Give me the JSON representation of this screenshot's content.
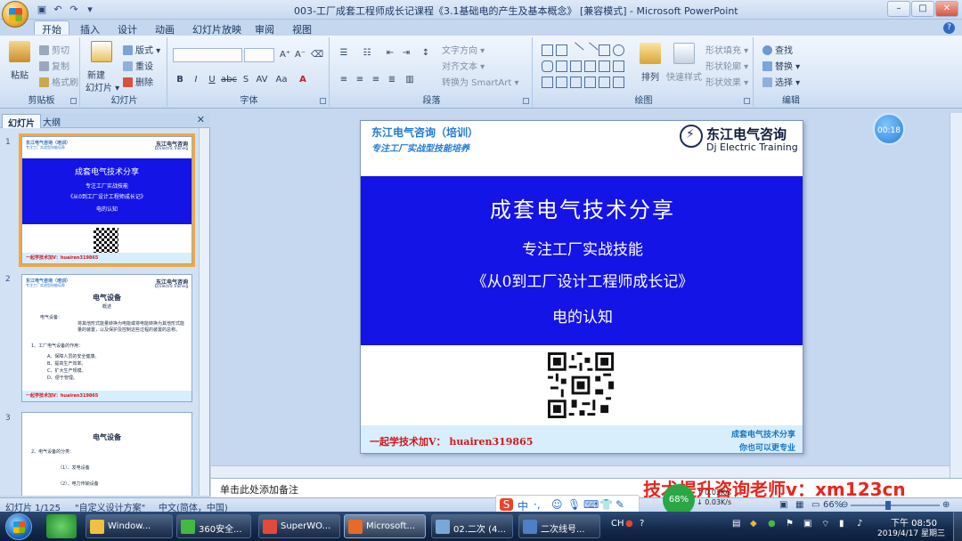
{
  "window": {
    "title": "003-工厂成套工程师成长记课程《3.1基础电的产生及基本概念》 [兼容模式] - Microsoft PowerPoint",
    "minimize": "–",
    "maximize": "□",
    "close": "✕"
  },
  "quick_access": [
    "save-icon",
    "undo-icon",
    "redo-icon"
  ],
  "tabs": [
    "开始",
    "插入",
    "设计",
    "动画",
    "幻灯片放映",
    "审阅",
    "视图"
  ],
  "ribbon": {
    "clipboard": {
      "label": "剪贴板",
      "paste": "粘贴",
      "cut": "剪切",
      "copy": "复制",
      "format_painter": "格式刷"
    },
    "slides": {
      "label": "幻灯片",
      "new_slide": "新建",
      "new_slide2": "幻灯片 ▾",
      "layout": "版式 ▾",
      "reset": "重设",
      "delete": "删除"
    },
    "font": {
      "label": "字体",
      "grow": "A⁺",
      "shrink": "A⁻",
      "bold": "B",
      "italic": "I",
      "underline": "U",
      "strike": "abc",
      "shadow": "S",
      "spacing": "AV",
      "case": "Aa",
      "color": "A"
    },
    "paragraph": {
      "label": "段落",
      "text_direction": "文字方向 ▾",
      "align_text": "对齐文本 ▾",
      "smartart": "转换为 SmartArt ▾"
    },
    "drawing": {
      "label": "绘图",
      "arrange": "排列",
      "quick_styles": "快速样式",
      "fill": "形状填充 ▾",
      "outline": "形状轮廓 ▾",
      "effects": "形状效果 ▾"
    },
    "editing": {
      "label": "编辑",
      "find": "查找",
      "replace": "替换 ▾",
      "select": "选择 ▾"
    }
  },
  "panel_tabs": [
    "幻灯片",
    "大纲"
  ],
  "panel_close": "✕",
  "thumbnails": [
    {
      "num": "1",
      "hdr1": "东江电气咨询（培训）",
      "hdr2": "专注工厂实战型技能培养",
      "logo": "东江电气咨询",
      "logo2": "Dj Electric Training",
      "line1": "成套电气技术分享",
      "line2": "专注工厂实战技能",
      "line3": "《从0到工厂设计工程师成长记》",
      "line4": "电的认知",
      "footer": "一起学技术加V：huairen319865"
    },
    {
      "num": "2",
      "title": "电气设备",
      "sub": "概述",
      "p1": "电气设备：",
      "p2": "将其他形式能量转换为电能或将电能转换为其他形式能量的装置，以及保护及控制这些过程的装置的总称。",
      "p3": "1、工厂电气设备的作用：",
      "items": [
        "A、保障人员的安全健康。",
        "B、提高生产效率。",
        "C、扩大生产规模。",
        "D、便于管理。"
      ],
      "footer": "一起学技术加V：huairen319865"
    },
    {
      "num": "3",
      "title": "电气设备",
      "p1": "2、电气设备的分类：",
      "items": [
        "（1）、发电设备",
        "（2）、电力传输设备"
      ]
    }
  ],
  "slide": {
    "hdr1": "东江电气咨询（培训）",
    "hdr2": "专注工厂实战型技能培养",
    "logo_cn": "东江电气咨询",
    "logo_en": "Dj Electric Training",
    "title": "成套电气技术分享",
    "line2": "专注工厂实战技能",
    "line3": "《从0到工厂设计工程师成长记》",
    "line4": "电的认知",
    "footer": "一起学技术加V： huairen319865",
    "footer_r1": "成套电气技术分享",
    "footer_r2": "你也可以更专业"
  },
  "timer": "00:18",
  "notes": "单击此处添加备注",
  "watermark": "技术提升咨询老师v：xm123cn",
  "statusbar": {
    "slide_count": "幻灯片 1/125",
    "theme": "\"自定义设计方案\"",
    "language": "中文(简体，中国)",
    "zoom": "66%",
    "zoom_minus": "⊖",
    "zoom_plus": "⊕"
  },
  "ime": {
    "s": "S",
    "lang": "中",
    "punct": "·,"
  },
  "net": {
    "percent": "68%",
    "up": "↑ 0.03K/s",
    "down": "↓ 0.03K/s"
  },
  "taskbar": {
    "items": [
      {
        "label": "Window...",
        "color": "#f0c040"
      },
      {
        "label": "360安全...",
        "color": "#44b844"
      },
      {
        "label": "SuperWO...",
        "color": "#e04a3a"
      },
      {
        "label": "Microsoft...",
        "color": "#e46b2a"
      },
      {
        "label": "02.二次 (4...",
        "color": "#7aa6d8"
      },
      {
        "label": "二次线号...",
        "color": "#4f7fc6"
      }
    ],
    "tray_lang": "CH",
    "time": "下午 08:50",
    "date": "2019/4/17 星期三"
  },
  "colors": {
    "slide_band": "#1414e6",
    "accent": "#1d7ad6",
    "footer_red": "#d0161c",
    "watermark": "#e8261f"
  }
}
